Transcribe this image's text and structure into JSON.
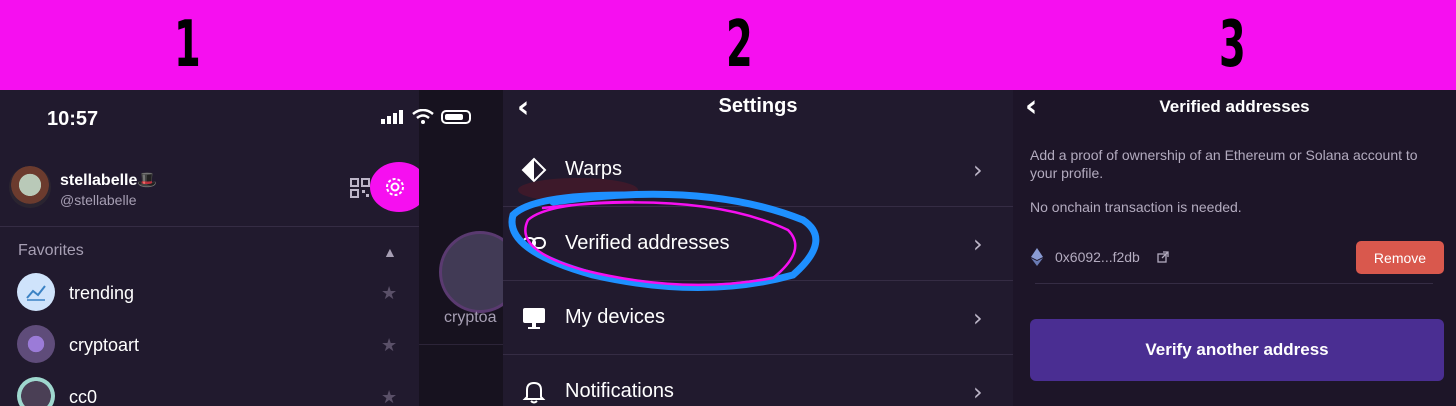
{
  "banner": {
    "steps": [
      "1",
      "2",
      "3"
    ],
    "color": "#f60ff0"
  },
  "panel1": {
    "status_time": "10:57",
    "user": {
      "display_name": "stellabelle🎩",
      "handle": "@stellabelle"
    },
    "favorites_label": "Favorites",
    "channels": [
      {
        "name": "trending"
      },
      {
        "name": "cryptoart"
      },
      {
        "name": "cc0"
      }
    ],
    "peek_channel": "cryptoa"
  },
  "panel2": {
    "title": "Settings",
    "rows": [
      {
        "label": "Warps",
        "icon": "diamond-icon"
      },
      {
        "label": "Verified addresses",
        "icon": "link-icon"
      },
      {
        "label": "My devices",
        "icon": "monitor-icon"
      },
      {
        "label": "Notifications",
        "icon": "bell-icon"
      }
    ]
  },
  "panel3": {
    "title": "Verified addresses",
    "description": "Add a proof of ownership of an Ethereum or Solana account to your profile.",
    "note": "No onchain transaction is needed.",
    "address": "0x6092...f2db",
    "remove_label": "Remove",
    "verify_label": "Verify another address"
  },
  "colors": {
    "accent_purple": "#4a2e92",
    "remove_red": "#d9584d",
    "annotation_pink": "#f60ff0",
    "annotation_blue": "#1e90ff"
  }
}
